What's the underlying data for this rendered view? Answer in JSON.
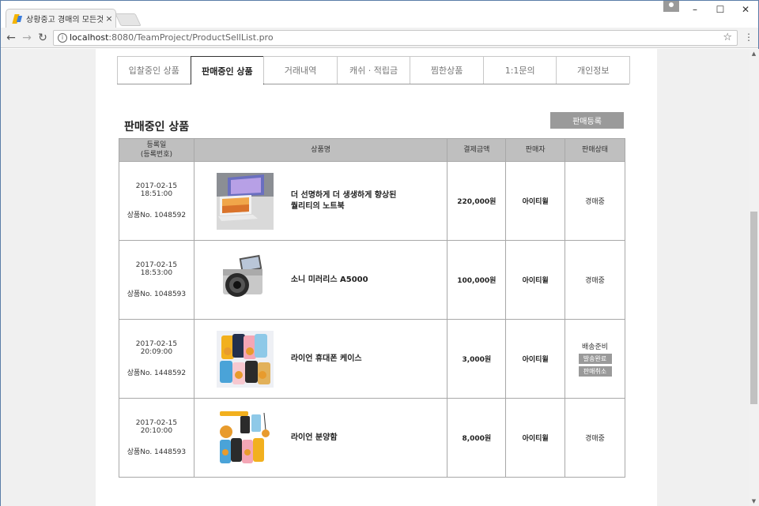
{
  "browser": {
    "tab_title": "상황중고 경매의 모든것",
    "tab_close": "×",
    "url_host": "localhost",
    "url_path": ":8080/TeamProject/ProductSellList.pro",
    "win_min": "–",
    "win_max": "☐",
    "win_close": "✕"
  },
  "nav_tabs": [
    {
      "label": "입찰중인 상품"
    },
    {
      "label": "판매중인 상품"
    },
    {
      "label": "거래내역"
    },
    {
      "label": "캐쉬 · 적립금"
    },
    {
      "label": "찜한상품"
    },
    {
      "label": "1:1문의"
    },
    {
      "label": "개인정보"
    }
  ],
  "section": {
    "title": "판매중인 상품",
    "register_button": "판매등록"
  },
  "table": {
    "headers": {
      "date_line1": "등록일",
      "date_line2": "(등록번호)",
      "name": "상품명",
      "price": "결제금액",
      "seller": "판매자",
      "status": "판매상태"
    },
    "rows": [
      {
        "date": "2017-02-15 18:51:00",
        "no": "상품No. 1048592",
        "name_line1": "더 선명하게 더 생생하게 향상된",
        "name_line2": "퀄리티의 노트북",
        "price": "220,000원",
        "seller": "아이티윌",
        "status": "경매중"
      },
      {
        "date": "2017-02-15 18:53:00",
        "no": "상품No. 1048593",
        "name_line1": "소니 미러리스 A5000",
        "name_line2": "",
        "price": "100,000원",
        "seller": "아이티윌",
        "status": "경매중"
      },
      {
        "date": "2017-02-15 20:09:00",
        "no": "상품No. 1448592",
        "name_line1": "라이언 휴대폰 케이스",
        "name_line2": "",
        "price": "3,000원",
        "seller": "아이티윌",
        "status": "배송준비",
        "btn1": "발송완료",
        "btn2": "판매취소"
      },
      {
        "date": "2017-02-15 20:10:00",
        "no": "상품No. 1448593",
        "name_line1": "라이언 분양함",
        "name_line2": "",
        "price": "8,000원",
        "seller": "아이티윌",
        "status": "경매중"
      }
    ]
  }
}
